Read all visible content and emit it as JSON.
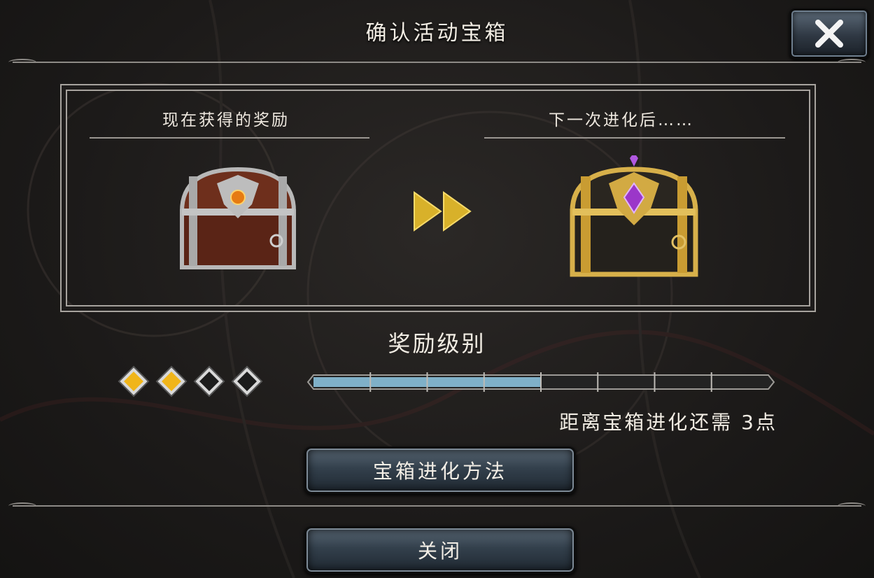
{
  "dialog": {
    "title": "确认活动宝箱",
    "close_icon": "close-x-icon"
  },
  "preview": {
    "current_label": "现在获得的奖励",
    "next_label": "下一次进化后……",
    "current_chest_icon": "bronze-chest-icon",
    "next_chest_icon": "gold-chest-icon",
    "arrow_icon": "fast-forward-icon"
  },
  "reward_level": {
    "title": "奖励级别",
    "level": 2,
    "max_level": 4,
    "progress_fraction": 0.5,
    "gauge_ticks": 8,
    "progress_text": "距离宝箱进化还需 3点"
  },
  "buttons": {
    "evolve_method": "宝箱进化方法",
    "close": "关闭"
  },
  "colors": {
    "gem_filled": "#f0b51a",
    "gauge_fill": "#7fb0c8",
    "arrow_gold": "#d8b12a"
  }
}
